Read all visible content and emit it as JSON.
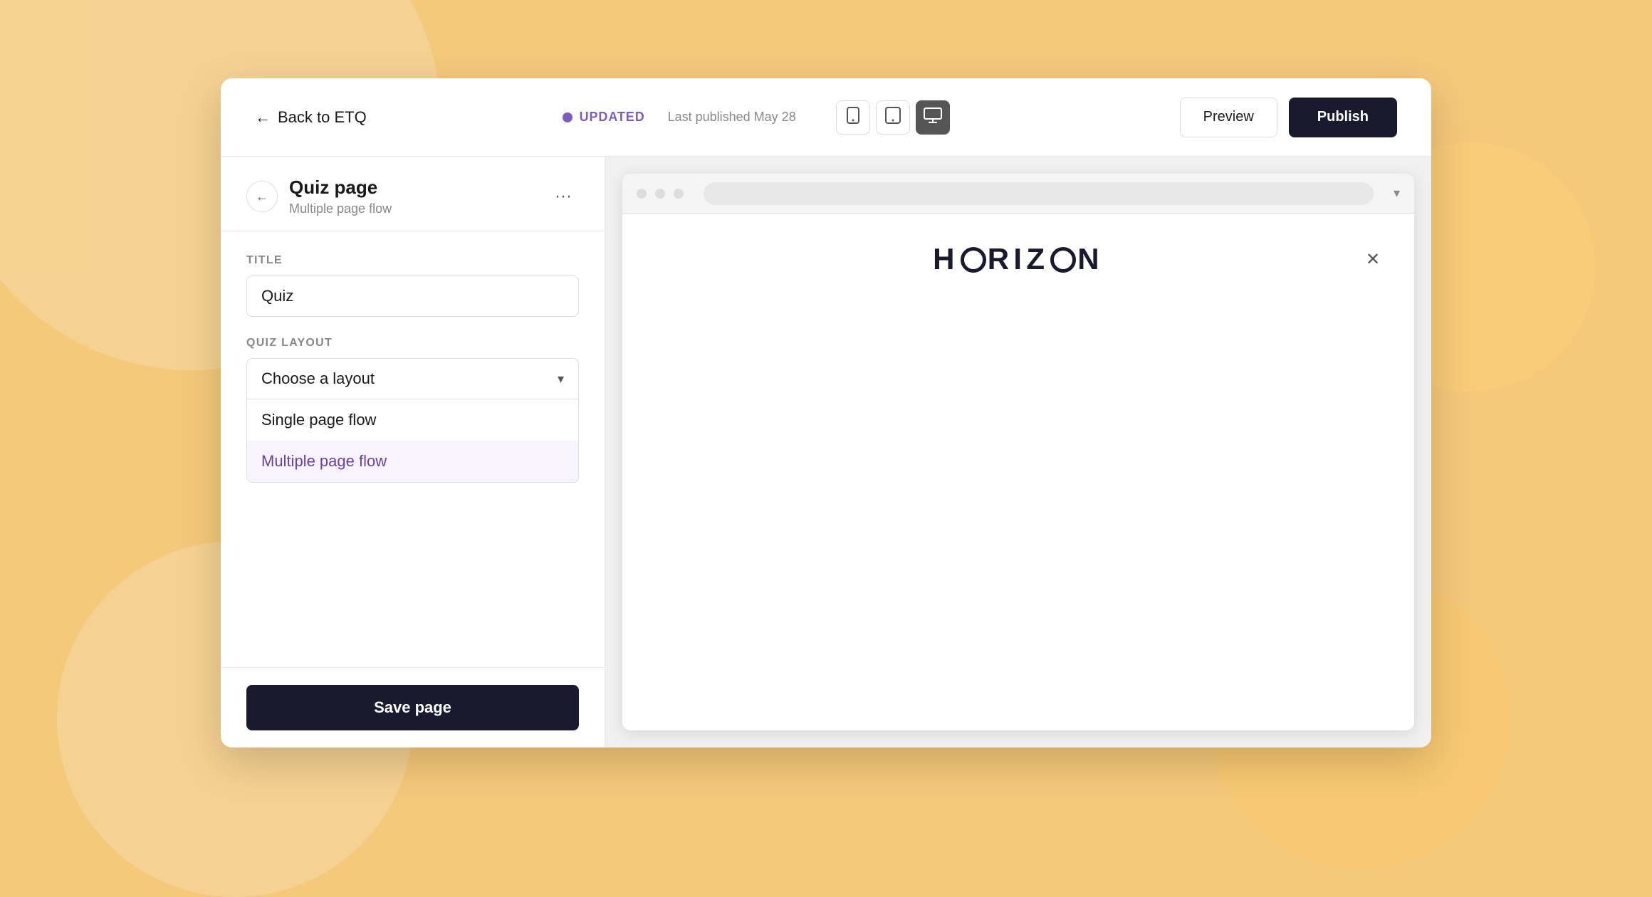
{
  "background": {
    "color": "#f5c97a"
  },
  "topbar": {
    "back_label": "Back to ETQ",
    "status_label": "UPDATED",
    "last_published": "Last published May 28",
    "preview_label": "Preview",
    "publish_label": "Publish"
  },
  "device_icons": {
    "mobile_icon": "📱",
    "tablet_icon": "⬛",
    "desktop_icon": "🖥"
  },
  "sidebar": {
    "title": "Quiz page",
    "subtitle": "Multiple page flow",
    "title_field_label": "TITLE",
    "title_value": "Quiz",
    "layout_field_label": "QUIZ LAYOUT",
    "layout_placeholder": "Choose a layout",
    "layout_options": [
      {
        "label": "Single page flow",
        "value": "single",
        "selected": false
      },
      {
        "label": "Multiple page flow",
        "value": "multiple",
        "selected": true
      }
    ],
    "save_label": "Save page"
  },
  "preview": {
    "brand_name": "HORIZON",
    "address_bar": ""
  }
}
